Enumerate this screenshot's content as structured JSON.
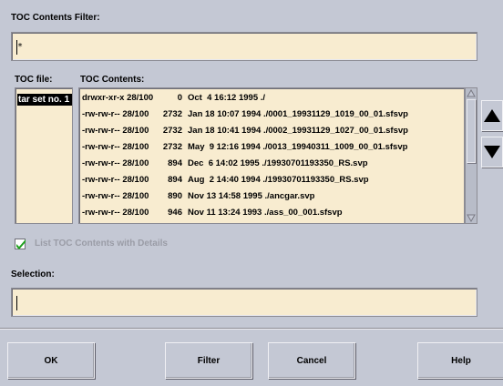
{
  "filter": {
    "label": "TOC Contents Filter:",
    "value": "*"
  },
  "toc_file": {
    "label": "TOC file:",
    "items": [
      "tar set no. 1"
    ]
  },
  "toc_contents": {
    "label": "TOC Contents:",
    "rows": [
      {
        "perm": "drwxr-xr-x 28/100",
        "size": "0",
        "date": "Oct  4 16:12 1995",
        "name": "./"
      },
      {
        "perm": "-rw-rw-r-- 28/100",
        "size": "2732",
        "date": "Jan 18 10:07 1994",
        "name": "./0001_19931129_1019_00_01.sfsvp"
      },
      {
        "perm": "-rw-rw-r-- 28/100",
        "size": "2732",
        "date": "Jan 18 10:41 1994",
        "name": "./0002_19931129_1027_00_01.sfsvp"
      },
      {
        "perm": "-rw-rw-r-- 28/100",
        "size": "2732",
        "date": "May  9 12:16 1994",
        "name": "./0013_19940311_1009_00_01.sfsvp"
      },
      {
        "perm": "-rw-rw-r-- 28/100",
        "size": "894",
        "date": "Dec  6 14:02 1995",
        "name": "./19930701193350_RS.svp"
      },
      {
        "perm": "-rw-rw-r-- 28/100",
        "size": "894",
        "date": "Aug  2 14:40 1994",
        "name": "./19930701193350_RS.svp"
      },
      {
        "perm": "-rw-rw-r-- 28/100",
        "size": "890",
        "date": "Nov 13 14:58 1995",
        "name": "./ancgar.svp"
      },
      {
        "perm": "-rw-rw-r-- 28/100",
        "size": "946",
        "date": "Nov 11 13:24 1993",
        "name": "./ass_00_001.sfsvp"
      }
    ]
  },
  "checkbox": {
    "label": "List TOC Contents with Details",
    "checked": true
  },
  "selection": {
    "label": "Selection:",
    "value": ""
  },
  "buttons": {
    "ok": "OK",
    "filter": "Filter",
    "cancel": "Cancel",
    "help": "Help"
  },
  "icons": {
    "up": "arrow-up-icon",
    "down": "arrow-down-icon",
    "check": "check-icon"
  },
  "colors": {
    "background": "#c4c8d4",
    "field": "#f8ecd0",
    "check": "#1ea01e"
  }
}
